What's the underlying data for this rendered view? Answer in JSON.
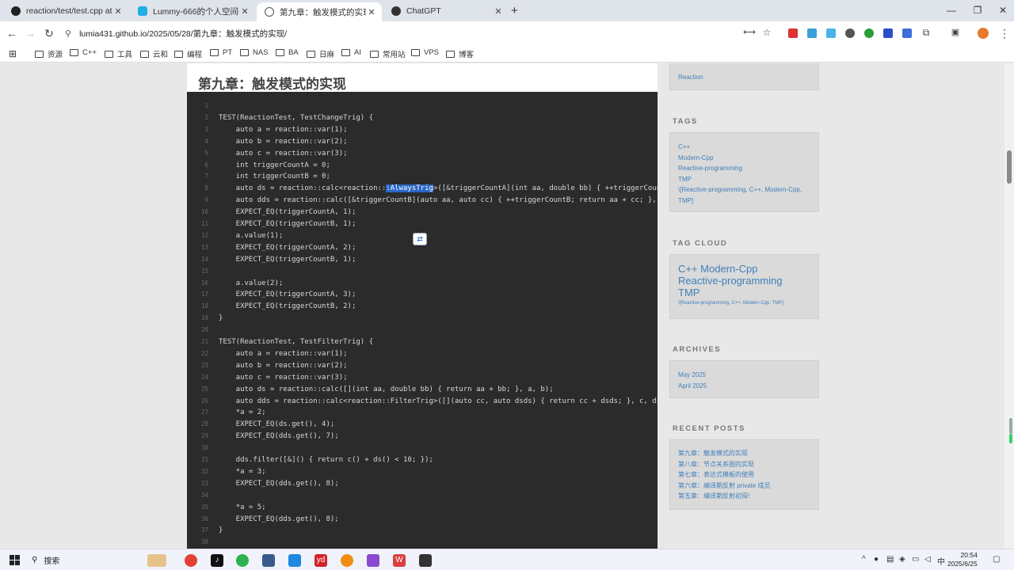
{
  "browser": {
    "tabs": [
      {
        "label": "reaction/test/test.cpp at ma",
        "icon": "github-icon",
        "active": false
      },
      {
        "label": "Lummy-666的个人空间-Lumm",
        "icon": "bilibili-icon",
        "active": false
      },
      {
        "label": "第九章：触发模式的实现 | Lum",
        "icon": "globe-icon",
        "active": true
      },
      {
        "label": "ChatGPT",
        "icon": "chatgpt-icon",
        "active": false
      }
    ],
    "url": "lumia431.github.io/2025/05/28/第九章：触发模式的实现/",
    "bookmarks": [
      "资源",
      "C++",
      "工具",
      "云和",
      "编程",
      "PT",
      "NAS",
      "BA",
      "日麻",
      "AI",
      "常用站",
      "VPS",
      "博客"
    ]
  },
  "article": {
    "title": "第九章：触发模式的实现",
    "code_lines": [
      {
        "n": "1",
        "text": ""
      },
      {
        "n": "2",
        "text": "TEST(ReactionTest, TestChangeTrig) {"
      },
      {
        "n": "3",
        "text": "    auto a = reaction::var(1);"
      },
      {
        "n": "4",
        "text": "    auto b = reaction::var(2);"
      },
      {
        "n": "5",
        "text": "    auto c = reaction::var(3);"
      },
      {
        "n": "6",
        "text": "    int triggerCountA = 0;"
      },
      {
        "n": "7",
        "text": "    int triggerCountB = 0;"
      },
      {
        "n": "8",
        "text": "    auto ds = reaction::calc<reaction::",
        "hl": ":AlwaysTrig",
        "rest": ">([&triggerCountA](int aa, double bb) { ++triggerCountA; re"
      },
      {
        "n": "9",
        "text": "    auto dds = reaction::calc([&triggerCountB](auto aa, auto cc) { ++triggerCountB; return aa + cc; }, a, c);"
      },
      {
        "n": "10",
        "text": "    EXPECT_EQ(triggerCountA, 1);"
      },
      {
        "n": "11",
        "text": "    EXPECT_EQ(triggerCountB, 1);"
      },
      {
        "n": "12",
        "text": "    a.value(1);"
      },
      {
        "n": "13",
        "text": "    EXPECT_EQ(triggerCountA, 2);"
      },
      {
        "n": "14",
        "text": "    EXPECT_EQ(triggerCountB, 1);"
      },
      {
        "n": "15",
        "text": ""
      },
      {
        "n": "16",
        "text": "    a.value(2);"
      },
      {
        "n": "17",
        "text": "    EXPECT_EQ(triggerCountA, 3);"
      },
      {
        "n": "18",
        "text": "    EXPECT_EQ(triggerCountB, 2);"
      },
      {
        "n": "19",
        "text": "}"
      },
      {
        "n": "20",
        "text": ""
      },
      {
        "n": "21",
        "text": "TEST(ReactionTest, TestFilterTrig) {"
      },
      {
        "n": "22",
        "text": "    auto a = reaction::var(1);"
      },
      {
        "n": "23",
        "text": "    auto b = reaction::var(2);"
      },
      {
        "n": "24",
        "text": "    auto c = reaction::var(3);"
      },
      {
        "n": "25",
        "text": "    auto ds = reaction::calc([](int aa, double bb) { return aa + bb; }, a, b);"
      },
      {
        "n": "26",
        "text": "    auto dds = reaction::calc<reaction::FilterTrig>([](auto cc, auto dsds) { return cc + dsds; }, c, ds);"
      },
      {
        "n": "27",
        "text": "    *a = 2;"
      },
      {
        "n": "28",
        "text": "    EXPECT_EQ(ds.get(), 4);"
      },
      {
        "n": "29",
        "text": "    EXPECT_EQ(dds.get(), 7);"
      },
      {
        "n": "30",
        "text": ""
      },
      {
        "n": "31",
        "text": "    dds.filter([&]() { return c() + ds() < 10; });"
      },
      {
        "n": "32",
        "text": "    *a = 3;"
      },
      {
        "n": "33",
        "text": "    EXPECT_EQ(dds.get(), 8);"
      },
      {
        "n": "34",
        "text": ""
      },
      {
        "n": "35",
        "text": "    *a = 5;"
      },
      {
        "n": "36",
        "text": "    EXPECT_EQ(dds.get(), 8);"
      },
      {
        "n": "37",
        "text": "}"
      },
      {
        "n": "38",
        "text": ""
      }
    ]
  },
  "sidebar": {
    "category_link": "Reaction",
    "tags_title": "TAGS",
    "tags": [
      "C++",
      "Modern-Cpp",
      "Reactive-programming",
      "TMP",
      "\\[Reactive-programming, C++, Modern-Cpp, TMP]"
    ],
    "tag_cloud_title": "TAG CLOUD",
    "tag_cloud_big": [
      "C++ Modern-Cpp",
      "Reactive-programming",
      "TMP"
    ],
    "tag_cloud_small": "\\[Reactive-programming, C++, Modern-Cpp, TMP]",
    "archives_title": "ARCHIVES",
    "archives": [
      "May 2025",
      "April 2025"
    ],
    "recent_title": "RECENT POSTS",
    "recent_posts": [
      "第九章：触发模式的实现",
      "第八章：节点关系图的实现",
      "第七章：表达式模板的使用",
      "第六章：编译期反射 private 成员",
      "第五章：编译期反射初探!"
    ]
  },
  "taskbar": {
    "search_label": "搜索",
    "ime": "中",
    "time": "20:54",
    "date": "2025/6/25"
  },
  "colors": {
    "code_bg": "#2b2b2b",
    "link": "#3f7fb8",
    "selection": "#2a67c7"
  }
}
